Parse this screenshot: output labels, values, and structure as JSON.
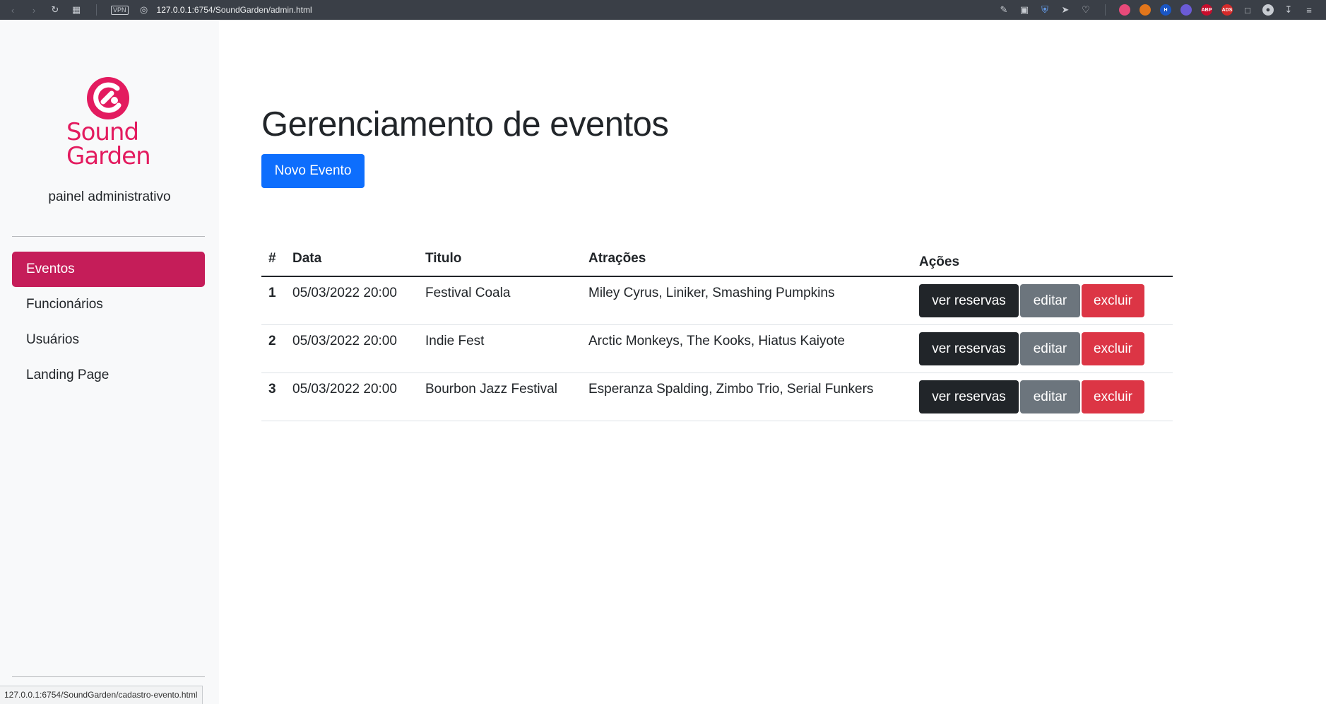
{
  "browser": {
    "url_host": "127.0.0.1",
    "url_rest": ":6754/SoundGarden/admin.html",
    "vpn_label": "VPN",
    "extensions": [
      {
        "name": "color-wheel-icon",
        "label": "",
        "color": "#e84a7a"
      },
      {
        "name": "fox-icon",
        "label": "",
        "color": "#e2761b"
      },
      {
        "name": "h-extension-icon",
        "label": "H",
        "color": "#1a56c4"
      },
      {
        "name": "chat-extension-icon",
        "label": "",
        "color": "#6b5bd6"
      },
      {
        "name": "abp-icon",
        "label": "ABP",
        "color": "#c70d2c"
      },
      {
        "name": "ads-icon",
        "label": "ADS",
        "color": "#d42a2a"
      }
    ]
  },
  "sidebar": {
    "logo_line1": "Sound",
    "logo_line2": "Garden",
    "subtitle": "painel administrativo",
    "items": [
      {
        "label": "Eventos",
        "active": true
      },
      {
        "label": "Funcionários",
        "active": false
      },
      {
        "label": "Usuários",
        "active": false
      },
      {
        "label": "Landing Page",
        "active": false
      }
    ]
  },
  "main": {
    "title": "Gerenciamento de eventos",
    "new_button": "Novo Evento",
    "table": {
      "headers": [
        "#",
        "Data",
        "Titulo",
        "Atrações",
        "Ações"
      ],
      "rows": [
        {
          "num": "1",
          "data": "05/03/2022 20:00",
          "titulo": "Festival Coala",
          "atracoes": "Miley Cyrus, Liniker, Smashing Pumpkins"
        },
        {
          "num": "2",
          "data": "05/03/2022 20:00",
          "titulo": "Indie Fest",
          "atracoes": "Arctic Monkeys, The Kooks, Hiatus Kaiyote"
        },
        {
          "num": "3",
          "data": "05/03/2022 20:00",
          "titulo": "Bourbon Jazz Festival",
          "atracoes": "Esperanza Spalding, Zimbo Trio, Serial Funkers"
        }
      ],
      "actions": {
        "view": "ver reservas",
        "edit": "editar",
        "delete": "excluir"
      }
    }
  },
  "statusbar": {
    "link": "127.0.0.1:6754/SoundGarden/cadastro-evento.html"
  },
  "colors": {
    "brand": "#e31b5f",
    "active_nav": "#c51d59",
    "primary": "#0d6efd",
    "dark": "#212529",
    "secondary": "#6c757d",
    "danger": "#dc3545"
  }
}
